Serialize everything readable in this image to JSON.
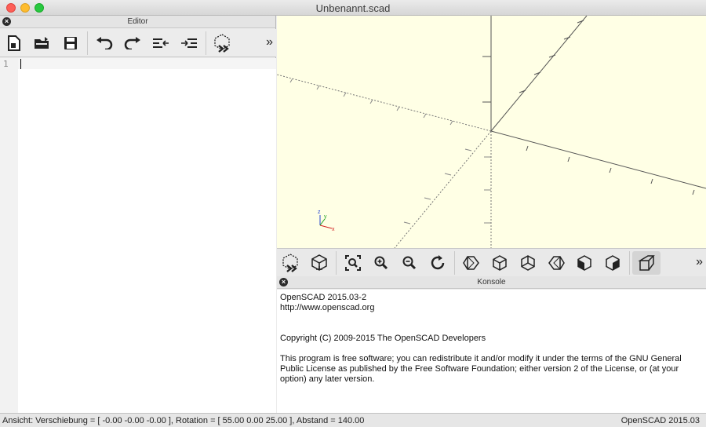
{
  "window": {
    "title": "Unbenannt.scad"
  },
  "editor": {
    "header_title": "Editor",
    "line_numbers": [
      "1"
    ],
    "toolbar": [
      {
        "name": "new-file-icon",
        "label": "new"
      },
      {
        "name": "open-file-icon",
        "label": "open"
      },
      {
        "name": "save-icon",
        "label": "save"
      },
      {
        "name": "undo-icon",
        "label": "undo"
      },
      {
        "name": "redo-icon",
        "label": "redo"
      },
      {
        "name": "unindent-icon",
        "label": "unindent"
      },
      {
        "name": "indent-icon",
        "label": "indent"
      },
      {
        "name": "preview-icon",
        "label": "preview"
      }
    ],
    "more": "»"
  },
  "view_toolbar": {
    "more": "»",
    "buttons": [
      "preview",
      "render",
      "view-all",
      "zoom-in",
      "zoom-out",
      "reset-view",
      "view-right",
      "view-top",
      "view-bottom",
      "view-left",
      "view-front",
      "view-back",
      "perspective"
    ]
  },
  "console": {
    "header_title": "Konsole",
    "lines": {
      "version": "OpenSCAD 2015.03-2",
      "url": "http://www.openscad.org",
      "copyright": "Copyright (C) 2009-2015 The OpenSCAD Developers",
      "license": "This program is free software; you can redistribute it and/or modify it under the terms of the GNU General Public License as published by the Free Software Foundation; either version 2 of the License, or (at your option) any later version."
    }
  },
  "status": {
    "left": "Ansicht: Verschiebung = [ -0.00 -0.00 -0.00 ], Rotation = [ 55.00 0.00 25.00 ], Abstand = 140.00",
    "right": "OpenSCAD 2015.03"
  },
  "axes_labels": {
    "x": "x",
    "y": "y",
    "z": "z"
  },
  "colors": {
    "viewport_bg": "#ffffe5",
    "axis": "#666666",
    "x_axis_small": "#d22020",
    "y_axis_small": "#20a020",
    "z_axis_small": "#2040d0"
  }
}
